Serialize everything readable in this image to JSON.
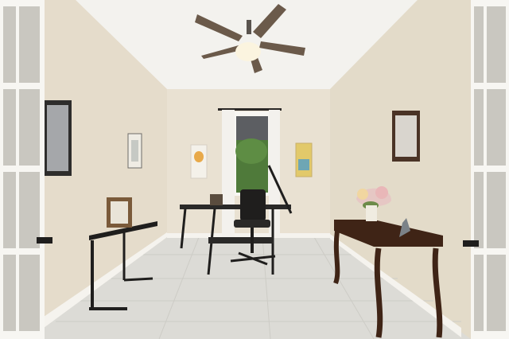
{
  "scene": {
    "description_tag": "",
    "palette": {
      "wall_left": "#e6ddcc",
      "wall_back": "#e9e1d2",
      "wall_right": "#e4dccb",
      "ceiling": "#f3f1ec",
      "floor": "#d9d8d3",
      "floor_grout": "#c9c8c2",
      "baseboard": "#f4f2ec",
      "door_frame": "#f7f6f2",
      "glass": "#c9c7c0",
      "dark_wood": "#3f2416",
      "metal_black": "#1f1e1d",
      "fan_blade": "#6b5a4a",
      "fan_light": "#fbf6e6",
      "greenery": "#4f7a3a",
      "curtain": "#f2f0ec"
    }
  }
}
